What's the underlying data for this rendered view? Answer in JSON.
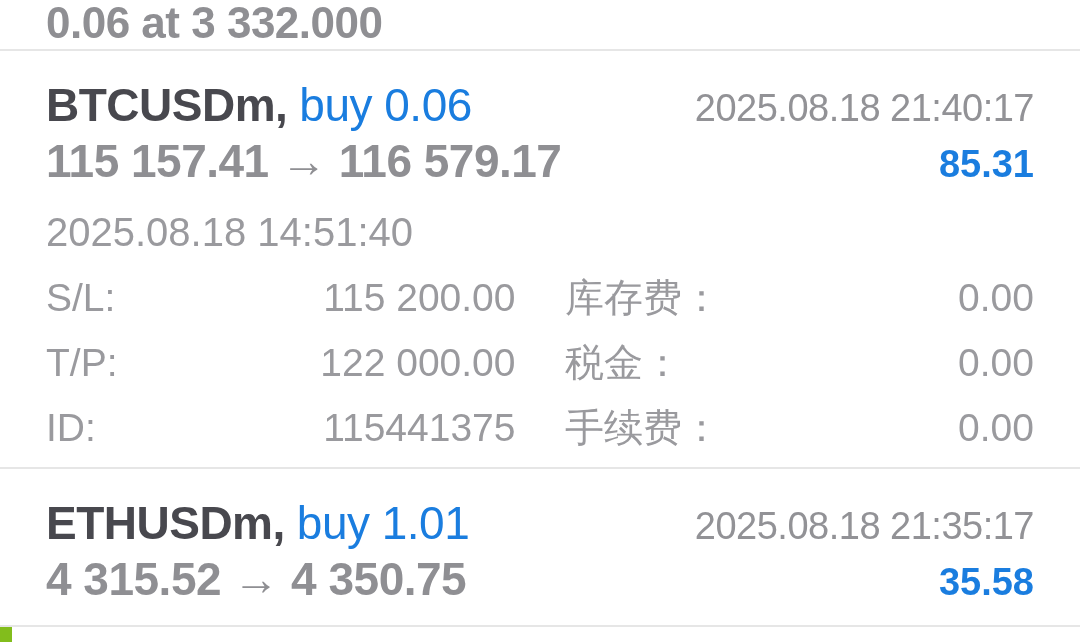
{
  "top_partial": {
    "text": "0.06 at 3 332.000"
  },
  "trades": [
    {
      "symbol": "BTCUSDm,",
      "order": "buy 0.06",
      "prices": "115 157.41 → 116 579.17",
      "close_time": "2025.08.18 21:40:17",
      "profit": "85.31",
      "expanded": true,
      "open_time": "2025.08.18 14:51:40",
      "details": [
        {
          "label": "S/L:",
          "value": "115 200.00",
          "label_2": "库存费：",
          "value_2": "0.00"
        },
        {
          "label": "T/P:",
          "value": "122 000.00",
          "label_2": "税金：",
          "value_2": "0.00"
        },
        {
          "label": "ID:",
          "value": "115441375",
          "label_2": "手续费：",
          "value_2": "0.00"
        }
      ]
    },
    {
      "symbol": "ETHUSDm,",
      "order": "buy 1.01",
      "prices": "4 315.52 → 4 350.75",
      "close_time": "2025.08.18 21:35:17",
      "profit": "35.58",
      "expanded": false
    }
  ],
  "next_row": {
    "marked": true
  }
}
